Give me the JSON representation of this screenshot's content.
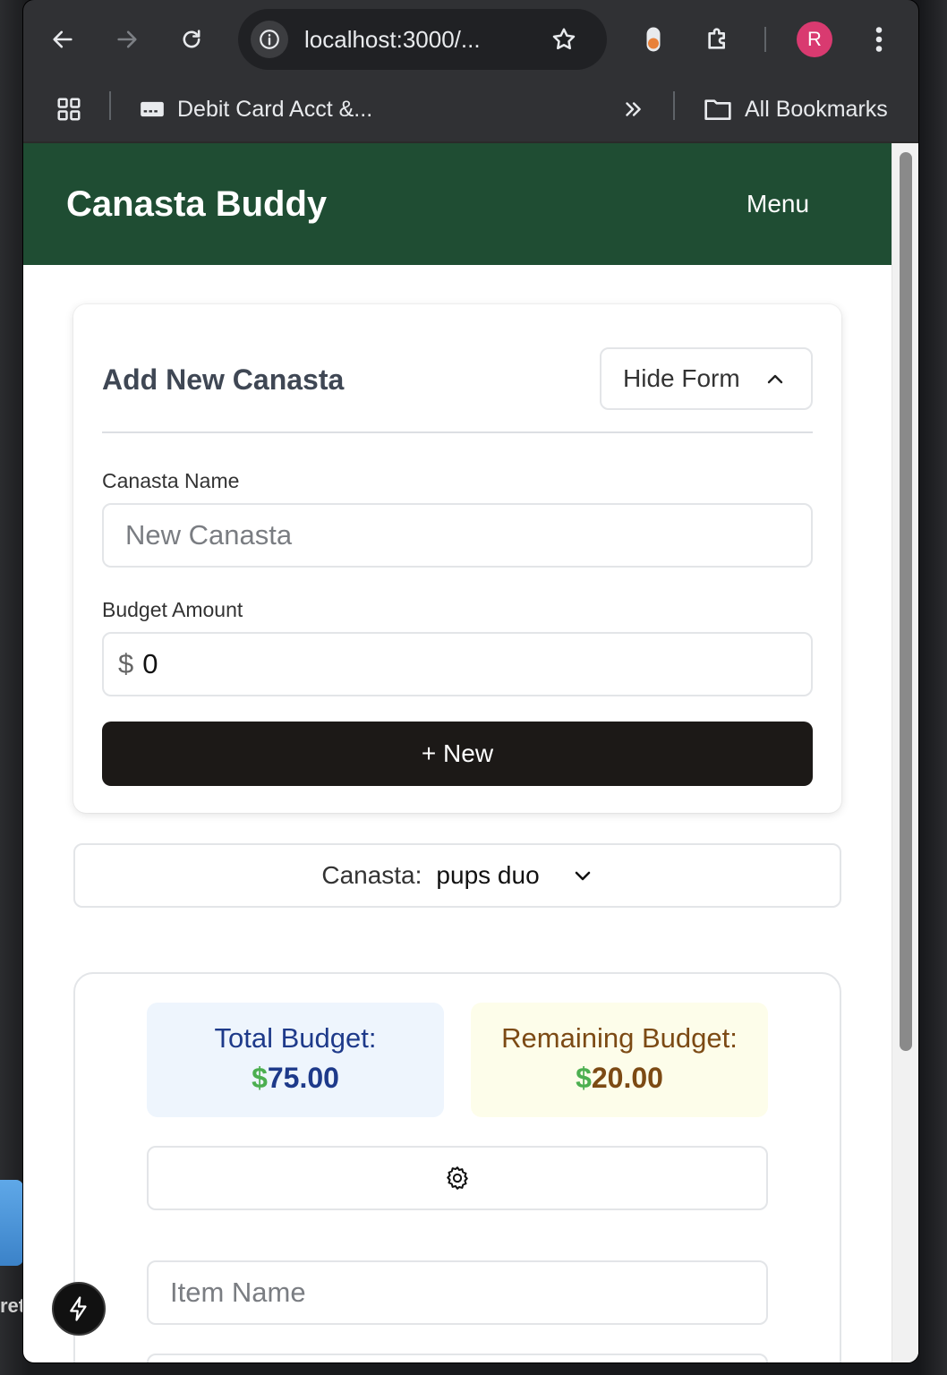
{
  "browser": {
    "url": "localhost:3000/...",
    "bookmark_item": "Debit Card Acct &...",
    "all_bookmarks": "All Bookmarks",
    "profile_initial": "R",
    "overflow_chevrons": "»"
  },
  "app": {
    "title": "Canasta Buddy",
    "menu_label": "Menu"
  },
  "form": {
    "title": "Add New Canasta",
    "toggle_label": "Hide Form",
    "name_label": "Canasta Name",
    "name_placeholder": "New Canasta",
    "budget_label": "Budget Amount",
    "currency_symbol": "$",
    "budget_value": "0",
    "submit_label": "+ New"
  },
  "selector": {
    "label": "Canasta:",
    "value": "pups duo"
  },
  "budget": {
    "total_label": "Total Budget:",
    "total_currency": "$",
    "total_value": "75.00",
    "remaining_label": "Remaining Budget:",
    "remaining_currency": "$",
    "remaining_value": "20.00"
  },
  "items": {
    "name_placeholder": "Item Name"
  },
  "desktop": {
    "partial_label": "ret"
  },
  "colors": {
    "header_bg": "#1f4d33",
    "primary_button": "#1c1917",
    "currency_green": "#4caf50",
    "total_text": "#1e3a8a",
    "remaining_text": "#7c4a14"
  }
}
